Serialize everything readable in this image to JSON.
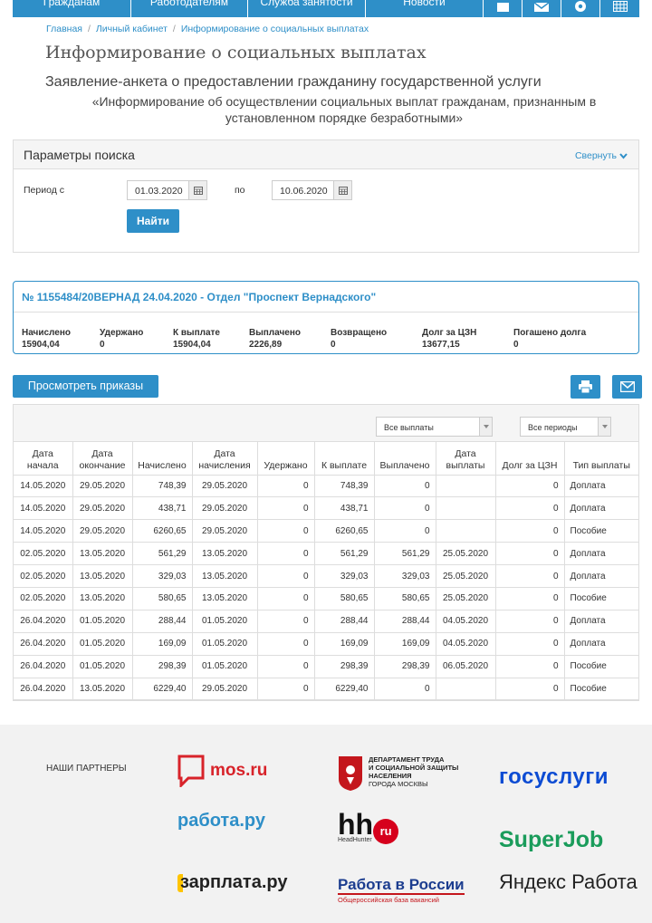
{
  "nav": {
    "items": [
      "Гражданам",
      "Работодателям",
      "Служба занятости",
      "Новости"
    ],
    "icons": [
      "document-icon",
      "mail-icon",
      "gear-icon",
      "calendar-icon"
    ]
  },
  "breadcrumb": [
    "Главная",
    "Личный кабинет",
    "Информирование о социальных выплатах"
  ],
  "page_title": "Информирование о социальных выплатах",
  "subtitle": "Заявление-анкета о предоставлении гражданину государственной услуги",
  "subtitle2": "«Информирование об осуществлении социальных выплат гражданам, признанным в установленном порядке безработными»",
  "search": {
    "title": "Параметры поиска",
    "collapse": "Свернуть",
    "period_label": "Период с",
    "date_from": "01.03.2020",
    "to_label": "по",
    "date_to": "10.06.2020",
    "find_button": "Найти"
  },
  "info": {
    "title": "№ 1155484/20ВЕРНАД 24.04.2020 - Отдел \"Проспект Вернадского\"",
    "cols": [
      {
        "label": "Начислено",
        "value": "15904,04"
      },
      {
        "label": "Удержано",
        "value": "0"
      },
      {
        "label": "К выплате",
        "value": "15904,04"
      },
      {
        "label": "Выплачено",
        "value": "2226,89"
      },
      {
        "label": "Возвращено",
        "value": "0"
      },
      {
        "label": "Долг за ЦЗН",
        "value": "13677,15"
      },
      {
        "label": "Погашено долга",
        "value": "0"
      }
    ]
  },
  "actions": {
    "orders_button": "Просмотреть приказы"
  },
  "filters": {
    "payments": "Все выплаты",
    "periods": "Все периоды"
  },
  "table": {
    "headers": [
      "Дата начала",
      "Дата окончание",
      "Начислено",
      "Дата начисления",
      "Удержано",
      "К выплате",
      "Выплачено",
      "Дата выплаты",
      "Долг за ЦЗН",
      "Тип выплаты"
    ],
    "rows": [
      [
        "14.05.2020",
        "29.05.2020",
        "748,39",
        "29.05.2020",
        "0",
        "748,39",
        "0",
        "",
        "0",
        "Доплата"
      ],
      [
        "14.05.2020",
        "29.05.2020",
        "438,71",
        "29.05.2020",
        "0",
        "438,71",
        "0",
        "",
        "0",
        "Доплата"
      ],
      [
        "14.05.2020",
        "29.05.2020",
        "6260,65",
        "29.05.2020",
        "0",
        "6260,65",
        "0",
        "",
        "0",
        "Пособие"
      ],
      [
        "02.05.2020",
        "13.05.2020",
        "561,29",
        "13.05.2020",
        "0",
        "561,29",
        "561,29",
        "25.05.2020",
        "0",
        "Доплата"
      ],
      [
        "02.05.2020",
        "13.05.2020",
        "329,03",
        "13.05.2020",
        "0",
        "329,03",
        "329,03",
        "25.05.2020",
        "0",
        "Доплата"
      ],
      [
        "02.05.2020",
        "13.05.2020",
        "580,65",
        "13.05.2020",
        "0",
        "580,65",
        "580,65",
        "25.05.2020",
        "0",
        "Пособие"
      ],
      [
        "26.04.2020",
        "01.05.2020",
        "288,44",
        "01.05.2020",
        "0",
        "288,44",
        "288,44",
        "04.05.2020",
        "0",
        "Доплата"
      ],
      [
        "26.04.2020",
        "01.05.2020",
        "169,09",
        "01.05.2020",
        "0",
        "169,09",
        "169,09",
        "04.05.2020",
        "0",
        "Доплата"
      ],
      [
        "26.04.2020",
        "01.05.2020",
        "298,39",
        "01.05.2020",
        "0",
        "298,39",
        "298,39",
        "06.05.2020",
        "0",
        "Пособие"
      ],
      [
        "26.04.2020",
        "13.05.2020",
        "6229,40",
        "29.05.2020",
        "0",
        "6229,40",
        "0",
        "",
        "0",
        "Пособие"
      ]
    ]
  },
  "footer": {
    "partners_label": "НАШИ ПАРТНЕРЫ",
    "logos": {
      "mos": "mos.ru",
      "dept_line1": "ДЕПАРТАМЕНТ ТРУДА",
      "dept_line2": "И СОЦИАЛЬНОЙ ЗАЩИТЫ",
      "dept_line3": "НАСЕЛЕНИЯ",
      "dept_line4": "ГОРОДА МОСКВЫ",
      "gos": "госуслуги",
      "rabota": "работа.ру",
      "hh": "hh",
      "hh_ru": "ru",
      "hh_sub": "HeadHunter",
      "superjob": "SuperJob",
      "zarplata": "зарплата.ру",
      "rvr": "Работа в России",
      "rvr_sub": "Общероссийская база вакансий",
      "yandex": "Яндекс Работа"
    }
  },
  "colors": {
    "accent": "#2e8fc8"
  }
}
